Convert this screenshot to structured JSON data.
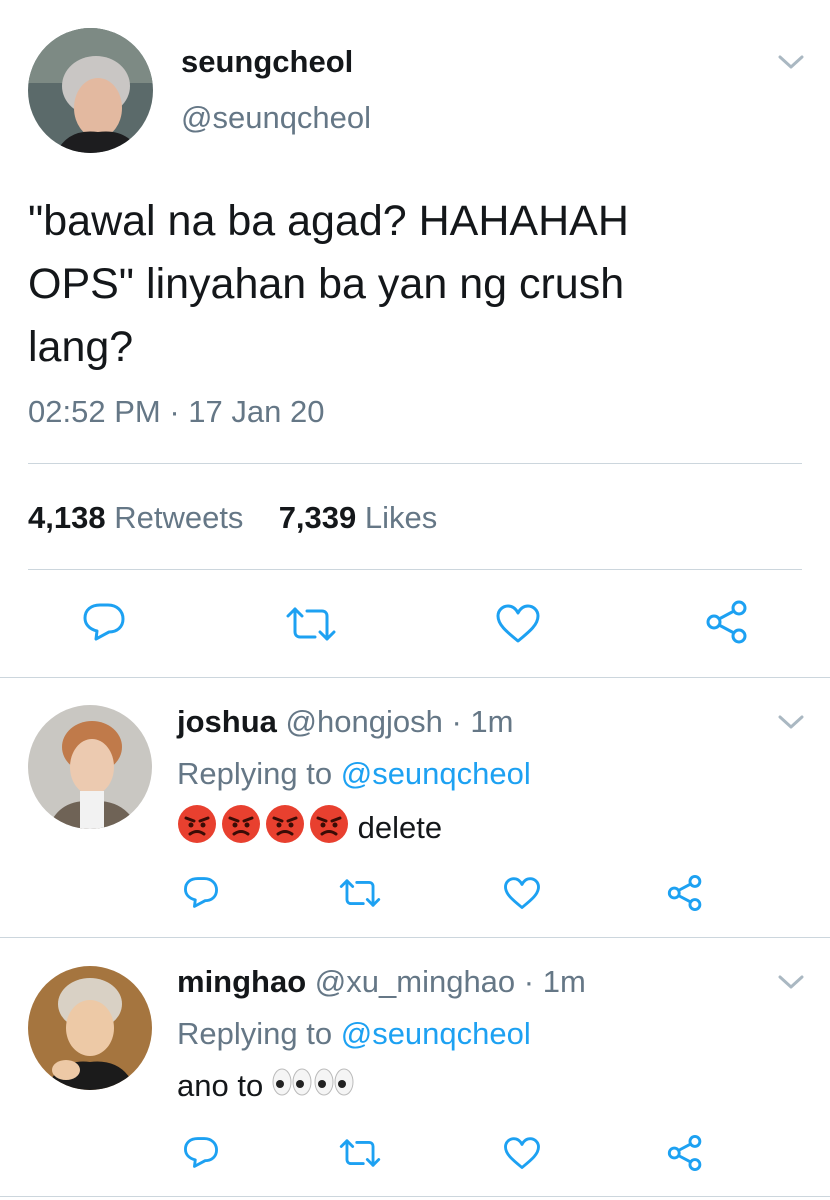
{
  "main_tweet": {
    "display_name": "seungcheol",
    "handle": "@seunqcheol",
    "text_line1": "\"bawal na ba agad? HAHAHAH",
    "text_line2": "OPS\" linyahan ba yan ng crush",
    "text_line3": "lang?",
    "time": "02:52 PM",
    "date_sep": "·",
    "date": "17 Jan 20",
    "retweet_count": "4,138",
    "retweet_label": "Retweets",
    "like_count": "7,339",
    "like_label": "Likes"
  },
  "replies": [
    {
      "display_name": "joshua",
      "handle": "@hongjosh",
      "sep": "·",
      "age": "1m",
      "replying_prefix": "Replying to",
      "replying_to": "@seunqcheol",
      "text": "delete",
      "emoji": "angry-face x4"
    },
    {
      "display_name": "minghao",
      "handle": "@xu_minghao",
      "sep": "·",
      "age": "1m",
      "replying_prefix": "Replying to",
      "replying_to": "@seunqcheol",
      "text": "ano to",
      "emoji": "eyes x2"
    }
  ],
  "colors": {
    "text": "#14171a",
    "secondary": "#657786",
    "link": "#1da1f2",
    "divider": "#ccd6dd",
    "icon": "#1da1f2"
  },
  "icons": [
    "chevron-down-icon",
    "reply-icon",
    "retweet-icon",
    "like-icon",
    "share-icon"
  ]
}
